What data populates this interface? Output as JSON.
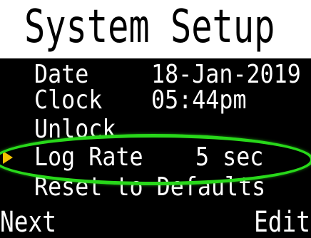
{
  "screen": {
    "title": "System Setup"
  },
  "menu": {
    "items": [
      {
        "label": "Date",
        "value": "18-Jan-2019"
      },
      {
        "label": "Clock",
        "value": "05:44pm"
      },
      {
        "label": "Unlock",
        "value": ""
      },
      {
        "label": "Log Rate",
        "value": "5 sec",
        "selected": true
      },
      {
        "label": "Reset to Defaults",
        "value": ""
      }
    ]
  },
  "footer": {
    "left_softkey": "Next",
    "right_softkey": "Edit"
  },
  "colors": {
    "title_background": "#ffffff",
    "screen_background": "#000000",
    "text": "#ffffff",
    "selection_arrow": "#f2c200",
    "highlight_ring": "#28d81a"
  },
  "icons": {
    "selection": "triangle-right-icon"
  }
}
